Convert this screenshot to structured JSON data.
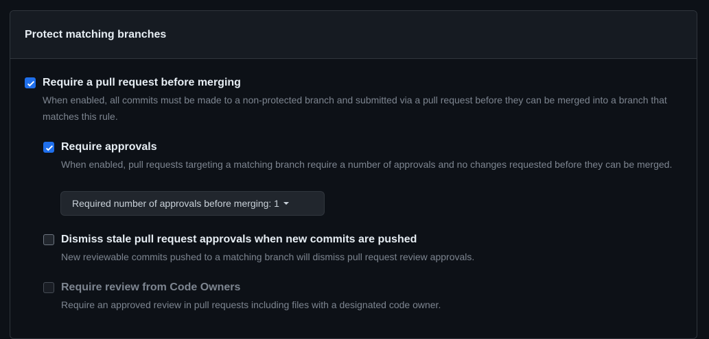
{
  "section_title": "Protect matching branches",
  "options": [
    {
      "label": "Require a pull request before merging",
      "description": "When enabled, all commits must be made to a non-protected branch and submitted via a pull request before they can be merged into a branch that matches this rule.",
      "checked": true
    },
    {
      "label": "Require approvals",
      "description": "When enabled, pull requests targeting a matching branch require a number of approvals and no changes requested before they can be merged.",
      "checked": true
    },
    {
      "label": "Dismiss stale pull request approvals when new commits are pushed",
      "description": "New reviewable commits pushed to a matching branch will dismiss pull request review approvals.",
      "checked": false
    },
    {
      "label": "Require review from Code Owners",
      "description": "Require an approved review in pull requests including files with a designated code owner.",
      "checked": false,
      "disabled": true
    }
  ],
  "approvals_dropdown": {
    "label": "Required number of approvals before merging: 1"
  },
  "colors": {
    "accent": "#1f6feb",
    "bg": "#0d1117",
    "header": "#161b22",
    "border": "#30363d"
  }
}
